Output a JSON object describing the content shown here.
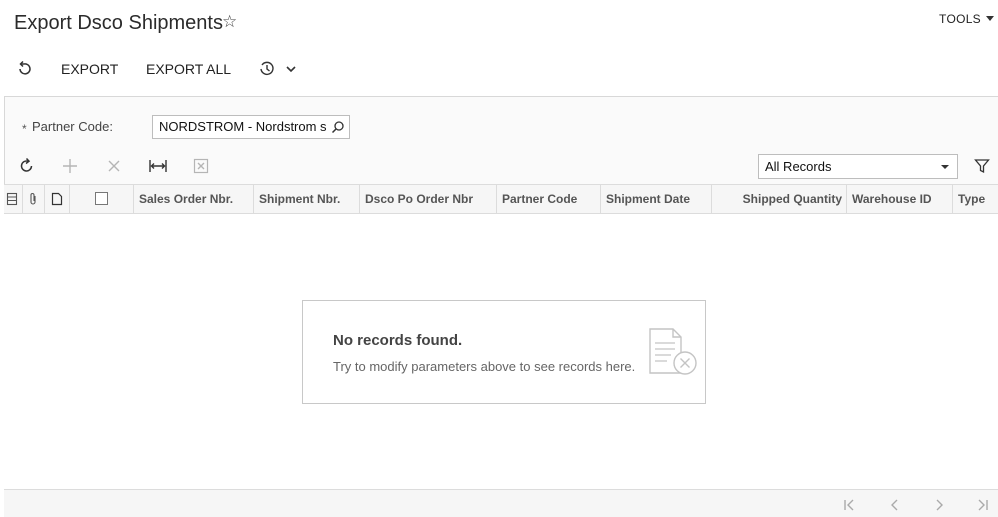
{
  "header": {
    "title": "Export Dsco Shipments",
    "tools_label": "TOOLS"
  },
  "toolbar": {
    "export_label": "EXPORT",
    "export_all_label": "EXPORT ALL"
  },
  "form": {
    "required_mark": "*",
    "partner_code_label": "Partner Code:",
    "partner_code_value": "NORDSTROM - Nordstrom s"
  },
  "grid": {
    "filter_selected": "All Records",
    "columns": [
      "Sales Order Nbr.",
      "Shipment Nbr.",
      "Dsco Po Order Nbr",
      "Partner Code",
      "Shipment Date",
      "Shipped Quantity",
      "Warehouse ID",
      "Type"
    ],
    "empty_title": "No records found.",
    "empty_subtitle": "Try to modify parameters above to see records here."
  },
  "icons": [
    "star-icon",
    "undo-icon",
    "history-icon",
    "refresh-icon",
    "add-icon",
    "delete-icon",
    "fit-width-icon",
    "excel-icon",
    "filter-icon",
    "search-icon",
    "files-icon",
    "attachment-icon",
    "note-icon",
    "first-page-icon",
    "prev-page-icon",
    "next-page-icon",
    "last-page-icon"
  ],
  "colors": {
    "disabled": "#b5b5b5",
    "border": "#dcdcdc",
    "text": "#222222"
  }
}
